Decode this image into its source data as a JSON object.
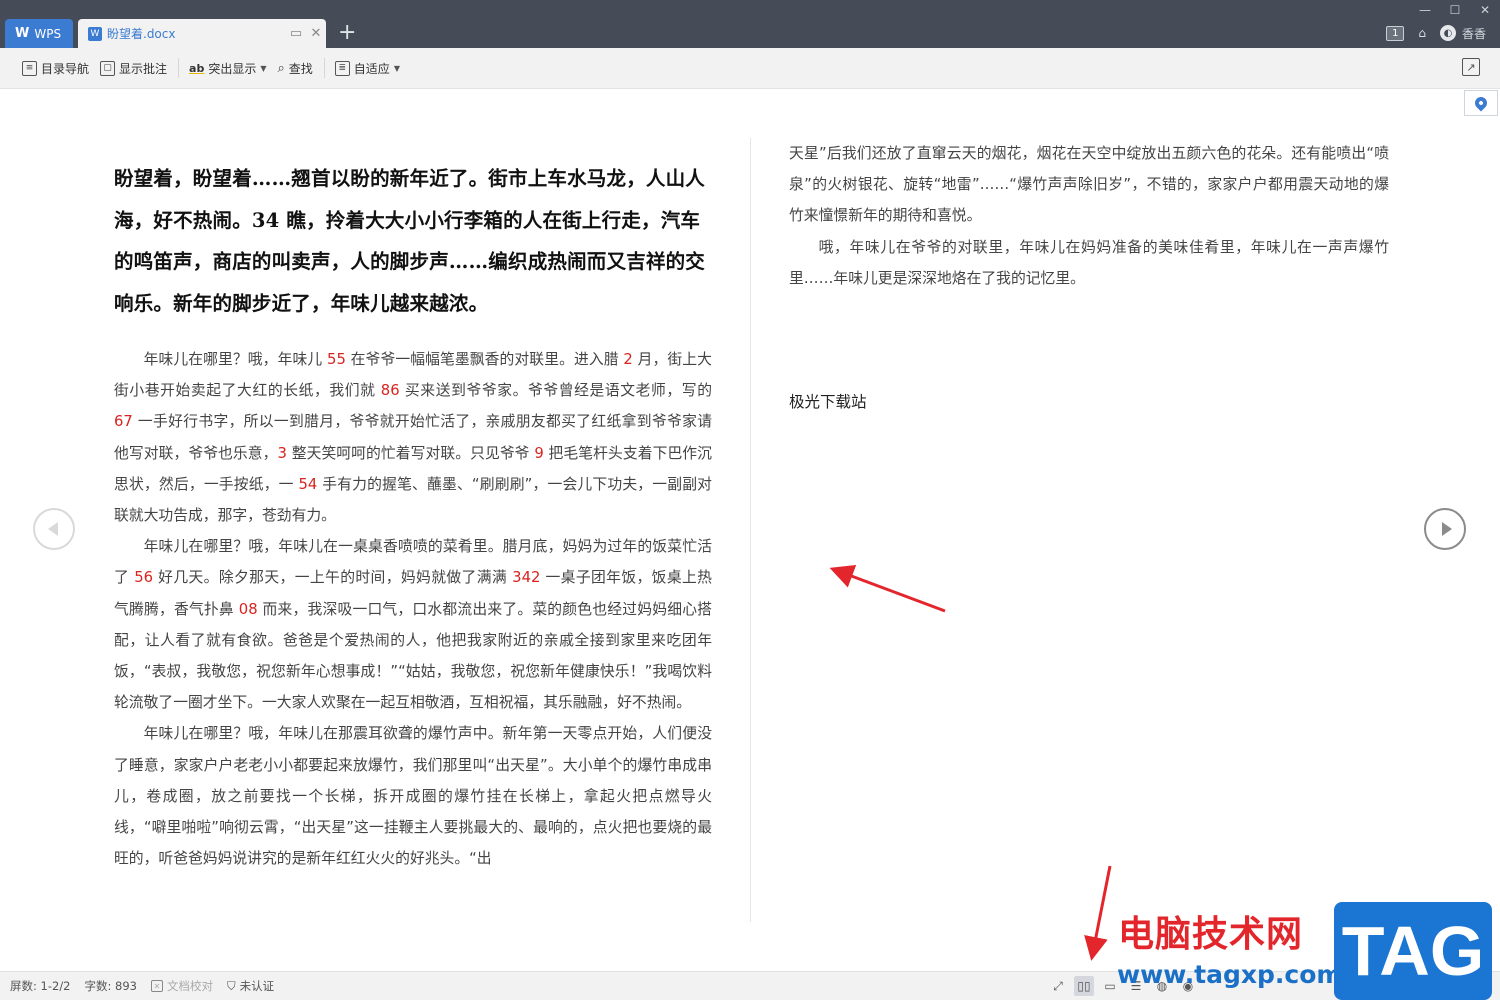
{
  "titlebar": {
    "wps_tab": "WPS",
    "doc_tab": "盼望着.docx",
    "window_count": "1",
    "user_name": "香香"
  },
  "toolbar": {
    "toc_nav": "目录导航",
    "show_comments": "显示批注",
    "highlight": "突出显示",
    "find": "查找",
    "fit": "自适应"
  },
  "document": {
    "heading": "盼望着，盼望着……翘首以盼的新年近了。街市上车水马龙，人山人海，好不热闹。34 瞧，拎着大大小小行李箱的人在街上行走，汽车的鸣笛声，商店的叫卖声，人的脚步声……编织成热闹而又吉祥的交响乐。新年的脚步近了，年味儿越来越浓。",
    "p1": {
      "s1": "年味儿在哪里？哦，年味儿 ",
      "n1": "55",
      "s2": " 在爷爷一幅幅笔墨飘香的对联里。进入腊 ",
      "n2": "2",
      "s3": " 月，街上大街小巷开始卖起了大红的长纸，我们就 ",
      "n3": "86",
      "s4": " 买来送到爷爷家。爷爷曾经是语文老师，写的 ",
      "n4": "67",
      "s5": " 一手好行书字，所以一到腊月，爷爷就开始忙活了，亲戚朋友都买了红纸拿到爷爷家请他写对联，爷爷也乐意，",
      "n5": "3",
      "s6": " 整天笑呵呵的忙着写对联。只见爷爷 ",
      "n6": "9",
      "s7": " 把毛笔杆头支着下巴作沉思状，然后，一手按纸，一 ",
      "n7": "54",
      "s8": " 手有力的握笔、蘸墨、“刷刷刷”，一会儿下功夫，一副副对联就大功告成，那字，苍劲有力。"
    },
    "p2": {
      "s1": "年味儿在哪里？哦，年味儿在一桌桌香喷喷的菜肴里。腊月底，妈妈为过年的饭菜忙活了 ",
      "n1": "56",
      "s2": " 好几天。除夕那天，一上午的时间，妈妈就做了满满 ",
      "n2": "342",
      "s3": " 一桌子团年饭，饭桌上热气腾腾，香气扑鼻 ",
      "n3": "08",
      "s4": " 而来，我深吸一口气，口水都流出来了。菜的颜色也经过妈妈细心搭配，让人看了就有食欲。爸爸是个爱热闹的人，他把我家附近的亲戚全接到家里来吃团年饭，“表叔，我敬您，祝您新年心想事成！”“姑姑，我敬您，祝您新年健康快乐！”我喝饮料轮流敬了一圈才坐下。一大家人欢聚在一起互相敬酒，互相祝福，其乐融融，好不热闹。"
    },
    "p3": "年味儿在哪里？哦，年味儿在那震耳欲聋的爆竹声中。新年第一天零点开始，人们便没了睡意，家家户户老老小小都要起来放爆竹，我们那里叫“出天星”。大小单个的爆竹串成串儿，卷成圈，放之前要找一个长梯，拆开成圈的爆竹挂在长梯上，拿起火把点燃导火线，“噼里啪啦”响彻云霄，“出天星”这一挂鞭主人要挑最大的、最响的，点火把也要烧的最旺的，听爸爸妈妈说讲究的是新年红红火火的好兆头。“出",
    "right_p1": "天星”后我们还放了直窜云天的烟花，烟花在天空中绽放出五颜六色的花朵。还有能喷出“喷泉”的火树银花、旋转“地雷”……“爆竹声声除旧岁”，不错的，家家户户都用震天动地的爆竹来憧憬新年的期待和喜悦。",
    "right_p2": "哦，年味儿在爷爷的对联里，年味儿在妈妈准备的美味佳肴里，年味儿在一声声爆竹里……年味儿更是深深地烙在了我的记忆里。",
    "site_name": "极光下载站"
  },
  "statusbar": {
    "screens": "屏数: 1-2/2",
    "words": "字数: 893",
    "proofread": "文档校对",
    "uncertified": "未认证"
  },
  "watermark": {
    "text": "电脑技术网",
    "url": "www.tagxp.com",
    "logo": "TAG"
  },
  "colors": {
    "titlebar_bg": "#454c57",
    "accent": "#3b7bd1",
    "number_red": "#d9231e",
    "arrow_red": "#e3262b"
  }
}
